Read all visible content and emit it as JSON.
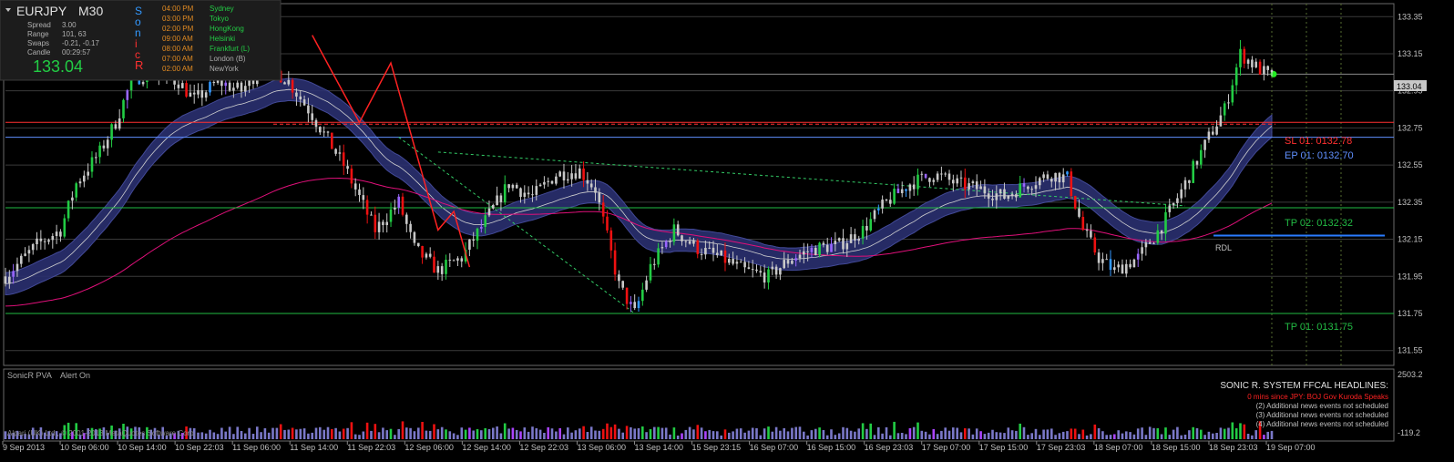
{
  "colors": {
    "background": "#000000",
    "grid": "#3a3a3a",
    "bull": "#c8c8c8",
    "bear": "#c8c8c8",
    "bull_accent": "#22cc44",
    "bear_accent": "#ee1111",
    "band_fill": "#2b3070",
    "band_edge": "#4a52a8",
    "ema_inner": "#d0d0d0",
    "ma_pink": "#e0107a",
    "sl": "#ff3030",
    "ep": "#6090ff",
    "tp": "#22bb44",
    "rdl": "#2a7bff",
    "zigzag": "#ff2222"
  },
  "info_panel": {
    "symbol": "EURJPY",
    "timeframe": "M30",
    "rows": [
      {
        "label": "Spread",
        "value": "3.00"
      },
      {
        "label": "Range",
        "value": "101, 63"
      },
      {
        "label": "Swaps",
        "value": "-0.21, -0.17"
      },
      {
        "label": "Candle",
        "value": "00:29:57"
      }
    ],
    "price": "133.04",
    "sonic_letters": [
      "S",
      "o",
      "n",
      "i",
      "c",
      "R"
    ],
    "sessions": [
      {
        "time": "04:00 PM",
        "name": "Sydney",
        "color": "#22cc44"
      },
      {
        "time": "03:00 PM",
        "name": "Tokyo",
        "color": "#22cc44"
      },
      {
        "time": "02:00 PM",
        "name": "HongKong",
        "color": "#22cc44"
      },
      {
        "time": "09:00 AM",
        "name": "Helsinki",
        "color": "#22cc44"
      },
      {
        "time": "08:00 AM",
        "name": "Frankfurt  (L)",
        "color": "#22cc44"
      },
      {
        "time": "07:00 AM",
        "name": "London  (B)",
        "color": "#aaaaaa"
      },
      {
        "time": "02:00 AM",
        "name": "NewYork",
        "color": "#aaaaaa"
      }
    ]
  },
  "level_labels": {
    "sl": "SL 01:  0132.78",
    "ep": "EP 01:  0132.70",
    "tp2": "TP 02:  0132.32",
    "tp1": "TP 01:  0131.75",
    "rdl": "RDL"
  },
  "current_price_tag": "133.04",
  "y_ticks": [
    "133.35",
    "133.15",
    "132.95",
    "132.75",
    "132.55",
    "132.35",
    "132.15",
    "131.95",
    "131.75",
    "131.55"
  ],
  "x_ticks": [
    "9 Sep 2013",
    "10 Sep 06:00",
    "10 Sep 14:00",
    "10 Sep 22:03",
    "11 Sep 06:00",
    "11 Sep 14:00",
    "11 Sep 22:03",
    "12 Sep 06:00",
    "12 Sep 14:00",
    "12 Sep 22:03",
    "13 Sep 06:00",
    "13 Sep 14:00",
    "15 Sep 23:15",
    "16 Sep 07:00",
    "16 Sep 15:00",
    "16 Sep 23:03",
    "17 Sep 07:00",
    "17 Sep 15:00",
    "17 Sep 23:03",
    "18 Sep 07:00",
    "18 Sep 15:00",
    "18 Sep 23:03",
    "19 Sep 07:00"
  ],
  "sub_window": {
    "title": "SonicR PVA",
    "alert": "Alert On",
    "y_top": "2503.2",
    "y_bottom": "-119.2",
    "copyright": "Alpari (UK) Ltd., © 2001-2013 MetaQuotes Software Corp."
  },
  "news": {
    "heading": "SONIC R. SYSTEM  FFCAL HEADLINES:",
    "lines": [
      {
        "text": "0 mins since JPY: BOJ Gov Kuroda Speaks",
        "color": "#ff2222"
      },
      {
        "text": "(2)  Additional news events not scheduled",
        "color": "#c0c0c0"
      },
      {
        "text": "(3)  Additional news events not scheduled",
        "color": "#c0c0c0"
      },
      {
        "text": "(4)  Additional news events not scheduled",
        "color": "#c0c0c0"
      }
    ]
  },
  "chart_data": {
    "type": "candlestick",
    "symbol": "EURJPY",
    "timeframe": "M30",
    "ylim": [
      131.47,
      133.42
    ],
    "levels": {
      "sl": 132.78,
      "ep": 132.7,
      "tp2": 132.32,
      "tp1": 131.75,
      "rdl": 132.17,
      "current": 133.04
    },
    "close_path": [
      [
        0,
        131.95
      ],
      [
        8,
        132.12
      ],
      [
        14,
        132.2
      ],
      [
        18,
        132.45
      ],
      [
        24,
        132.62
      ],
      [
        28,
        132.78
      ],
      [
        32,
        133.0
      ],
      [
        36,
        133.05
      ],
      [
        44,
        133.0
      ],
      [
        48,
        132.9
      ],
      [
        54,
        133.0
      ],
      [
        60,
        132.95
      ],
      [
        66,
        133.1
      ],
      [
        72,
        133.0
      ],
      [
        78,
        132.82
      ],
      [
        86,
        132.55
      ],
      [
        94,
        132.2
      ],
      [
        100,
        132.35
      ],
      [
        104,
        132.1
      ],
      [
        110,
        131.98
      ],
      [
        116,
        132.05
      ],
      [
        122,
        132.25
      ],
      [
        128,
        132.45
      ],
      [
        134,
        132.38
      ],
      [
        140,
        132.5
      ],
      [
        146,
        132.52
      ],
      [
        150,
        132.42
      ],
      [
        156,
        131.9
      ],
      [
        160,
        131.75
      ],
      [
        164,
        132.0
      ],
      [
        170,
        132.2
      ],
      [
        176,
        132.1
      ],
      [
        182,
        132.05
      ],
      [
        188,
        131.98
      ],
      [
        194,
        131.95
      ],
      [
        200,
        132.05
      ],
      [
        206,
        132.1
      ],
      [
        212,
        132.12
      ],
      [
        218,
        132.2
      ],
      [
        224,
        132.35
      ],
      [
        230,
        132.45
      ],
      [
        236,
        132.5
      ],
      [
        242,
        132.45
      ],
      [
        248,
        132.42
      ],
      [
        254,
        132.38
      ],
      [
        260,
        132.45
      ],
      [
        266,
        132.5
      ],
      [
        270,
        132.48
      ],
      [
        274,
        132.2
      ],
      [
        278,
        132.05
      ],
      [
        282,
        131.98
      ],
      [
        288,
        132.05
      ],
      [
        294,
        132.22
      ],
      [
        300,
        132.45
      ],
      [
        306,
        132.7
      ],
      [
        310,
        132.85
      ],
      [
        314,
        133.15
      ],
      [
        318,
        133.08
      ],
      [
        322,
        133.02
      ]
    ],
    "n_bars": 322,
    "x_ticks": [
      "9 Sep 2013",
      "10 Sep 06:00",
      "10 Sep 14:00",
      "10 Sep 22:03",
      "11 Sep 06:00",
      "11 Sep 14:00",
      "11 Sep 22:03",
      "12 Sep 06:00",
      "12 Sep 14:00",
      "12 Sep 22:03",
      "13 Sep 06:00",
      "13 Sep 14:00",
      "15 Sep 23:15",
      "16 Sep 07:00",
      "16 Sep 15:00",
      "16 Sep 23:03",
      "17 Sep 07:00",
      "17 Sep 15:00",
      "17 Sep 23:03",
      "18 Sep 07:00",
      "18 Sep 15:00",
      "18 Sep 23:03",
      "19 Sep 07:00"
    ],
    "y_ticks": [
      133.35,
      133.15,
      132.95,
      132.75,
      132.55,
      132.35,
      132.15,
      131.95,
      131.75,
      131.55
    ],
    "indicator": {
      "name": "SonicR PVA",
      "ylim": [
        -119.2,
        2503.2
      ]
    }
  }
}
